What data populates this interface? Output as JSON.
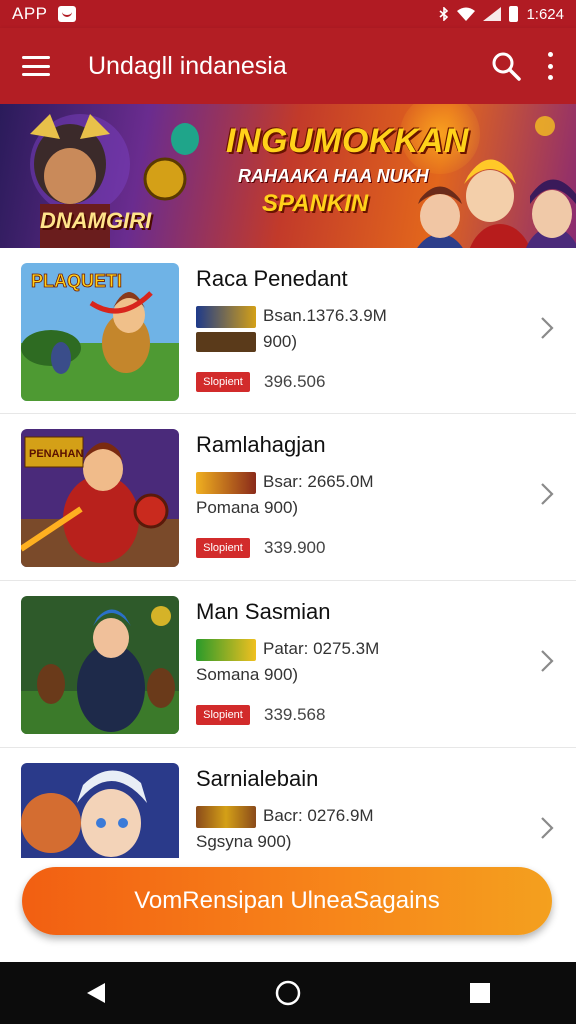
{
  "status_bar": {
    "app_label": "APP",
    "time": "1:624"
  },
  "app_bar": {
    "title": "Undagll indanesia",
    "icons": [
      "menu-icon",
      "search-icon",
      "more-vert-icon"
    ]
  },
  "banner": {
    "headline": "INGUMOKKAN",
    "subline": "RAHAAKA HAA NUKH",
    "subline2": "SPANKIN",
    "logo_text": "DNAMGIRI"
  },
  "games": [
    {
      "title": "Raca Penedant",
      "size": "Bsan.1376.3.9M",
      "sub": "900)",
      "badge": "Slopient",
      "count": "396.506",
      "thumb_label": "PLAQUETI"
    },
    {
      "title": "Ramlahagjan",
      "size": "Bsar: 2665.0M",
      "sub": "Pomana 900)",
      "badge": "Slopient",
      "count": "339.900",
      "thumb_label": "PENAHAN"
    },
    {
      "title": "Man Sasmian",
      "size": "Patar: 0275.3M",
      "sub": "Somana 900)",
      "badge": "Slopient",
      "count": "339.568",
      "thumb_label": ""
    },
    {
      "title": "Sarnialebain",
      "size": "Bacr: 0276.9M",
      "sub": "Sgsyna 900)",
      "badge": "",
      "count": "",
      "thumb_label": ""
    }
  ],
  "cta": {
    "label": "VomRensipan UlneaSagains"
  },
  "colors": {
    "primary_red": "#b31e24",
    "cta_orange": "#f7861a",
    "badge_red": "#d22b2b"
  }
}
